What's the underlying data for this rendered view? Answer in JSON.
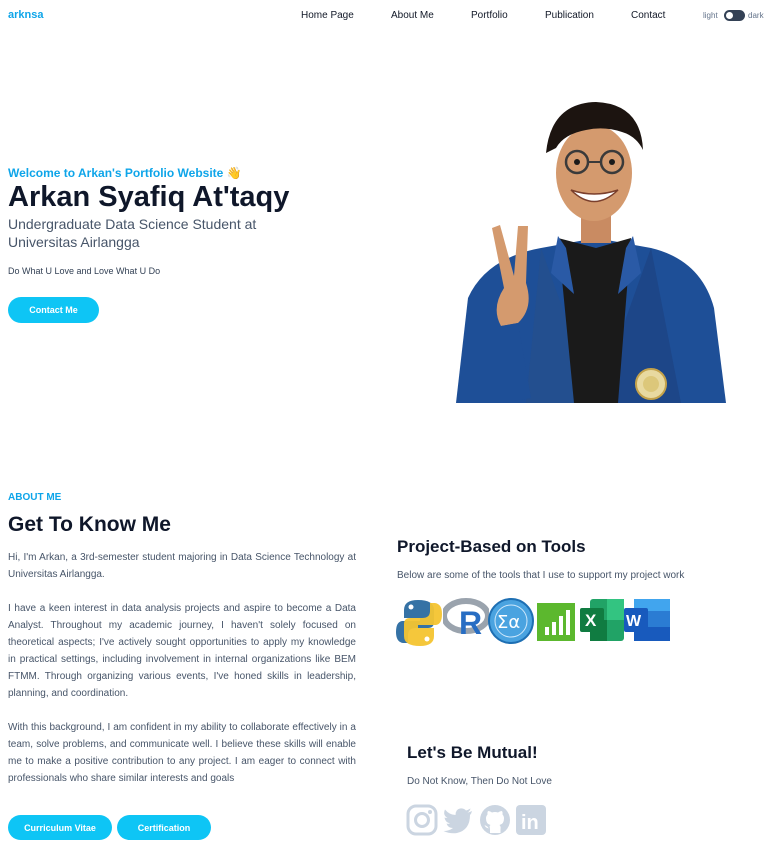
{
  "nav": {
    "logo": "arknsa",
    "items": [
      {
        "label": "Home Page"
      },
      {
        "label": "About Me"
      },
      {
        "label": "Portfolio"
      },
      {
        "label": "Publication"
      },
      {
        "label": "Contact"
      }
    ],
    "mode_light": "light",
    "mode_dark": "dark"
  },
  "hero": {
    "welcome": "Welcome to Arkan's Portfolio Website 👋",
    "name": "Arkan Syafiq At'taqy",
    "subtitle": "Undergraduate Data Science Student at Universitas Airlangga",
    "tagline": "Do What U Love and Love What U Do",
    "contact_button": "Contact Me"
  },
  "about": {
    "label": "ABOUT ME",
    "title": "Get To Know Me",
    "paragraphs": [
      "Hi, I'm Arkan, a 3rd-semester student majoring in Data Science Technology at Universitas Airlangga.",
      "I have a keen interest in data analysis projects and aspire to become a Data Analyst. Throughout my academic journey, I haven't solely focused on theoretical aspects; I've actively sought opportunities to apply my knowledge in practical settings, including involvement in internal organizations like BEM FTMM. Through organizing various events, I've honed skills in leadership, planning, and coordination.",
      "With this background, I am confident in my ability to collaborate effectively in a team, solve problems, and communicate well. I believe these skills will enable me to make a positive contribution to any project. I am eager to connect with professionals who share similar interests and goals"
    ],
    "cv_button": "Curriculum Vitae",
    "cert_button": "Certification"
  },
  "tools": {
    "title": "Project-Based on Tools",
    "description": "Below are some of the tools that I use to support my project work",
    "items": [
      {
        "icon": "python-icon"
      },
      {
        "icon": "r-icon",
        "glyph": "R"
      },
      {
        "icon": "sigma-icon",
        "glyph": "Σα"
      },
      {
        "icon": "chart-app-icon"
      },
      {
        "icon": "excel-icon",
        "glyph": "X"
      },
      {
        "icon": "word-icon",
        "glyph": "W"
      }
    ]
  },
  "mutual": {
    "title": "Let's Be Mutual!",
    "description": "Do Not Know, Then Do Not Love",
    "socials": [
      {
        "icon": "instagram-icon"
      },
      {
        "icon": "twitter-icon"
      },
      {
        "icon": "github-icon"
      },
      {
        "icon": "linkedin-icon",
        "glyph": "in"
      }
    ]
  },
  "colors": {
    "accent": "#0ec5f5",
    "heading": "#0f172a",
    "body_text": "#475569",
    "social_icon": "#cbd5e1"
  }
}
